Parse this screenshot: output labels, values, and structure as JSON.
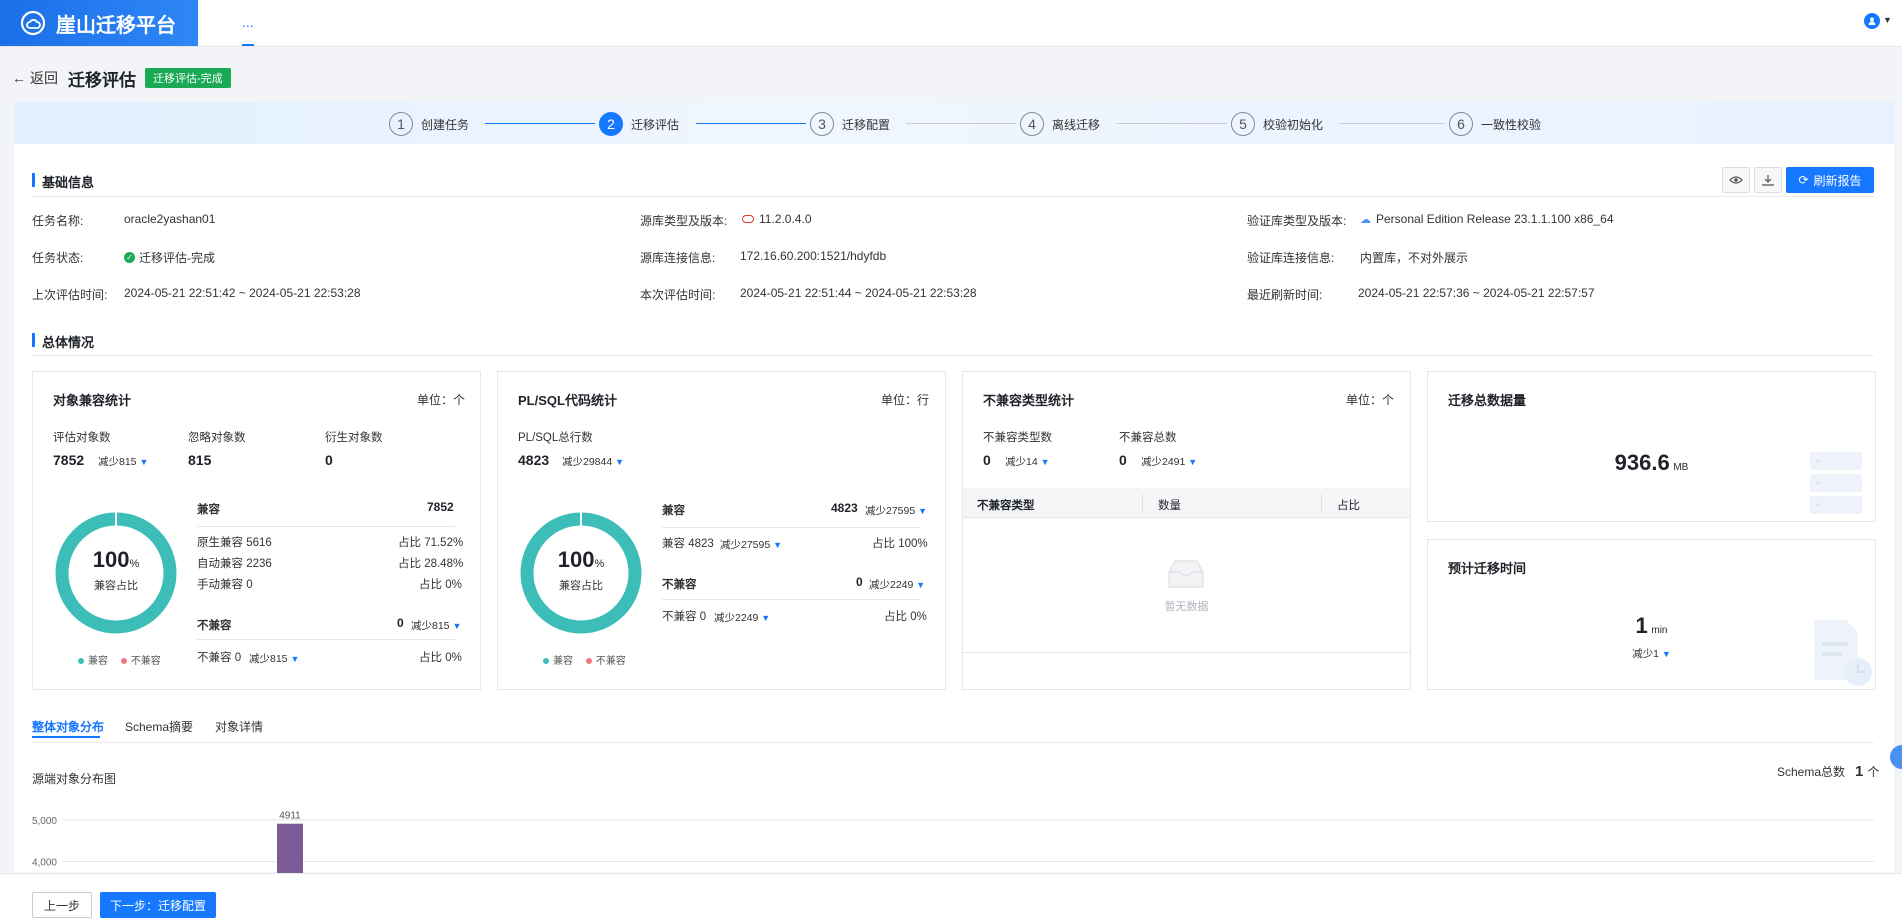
{
  "app": {
    "title": "崖山迁移平台",
    "nav_more": "..."
  },
  "header": {
    "back_label": "返回",
    "page_title": "迁移评估",
    "status_tag": "迁移评估-完成"
  },
  "steps": [
    {
      "num": "1",
      "label": "创建任务"
    },
    {
      "num": "2",
      "label": "迁移评估"
    },
    {
      "num": "3",
      "label": "迁移配置"
    },
    {
      "num": "4",
      "label": "离线迁移"
    },
    {
      "num": "5",
      "label": "校验初始化"
    },
    {
      "num": "6",
      "label": "一致性校验"
    }
  ],
  "basic": {
    "title": "基础信息",
    "refresh_label": "刷新报告",
    "task_name_label": "任务名称:",
    "task_name": "oracle2yashan01",
    "task_status_label": "任务状态:",
    "task_status": "迁移评估-完成",
    "last_eval_label": "上次评估时间:",
    "last_eval": "2024-05-21 22:51:42 ~ 2024-05-21 22:53:28",
    "src_type_label": "源库类型及版本:",
    "src_type": "11.2.0.4.0",
    "src_conn_label": "源库连接信息:",
    "src_conn": "172.16.60.200:1521/hdyfdb",
    "this_eval_label": "本次评估时间:",
    "this_eval": "2024-05-21 22:51:44 ~ 2024-05-21 22:53:28",
    "dst_type_label": "验证库类型及版本:",
    "dst_type": "Personal Edition Release 23.1.1.100 x86_64",
    "dst_conn_label": "验证库连接信息:",
    "dst_conn": "内置库，不对外展示",
    "refresh_time_label": "最近刷新时间:",
    "refresh_time": "2024-05-21 22:57:36 ~ 2024-05-21 22:57:57"
  },
  "overall": {
    "title": "总体情况"
  },
  "obj_card": {
    "title": "对象兼容统计",
    "unit": "单位：个",
    "eval_label": "评估对象数",
    "eval_value": "7852",
    "eval_delta": "减少815",
    "ignore_label": "忽略对象数",
    "ignore_value": "815",
    "derive_label": "衍生对象数",
    "derive_value": "0",
    "donut_pct": "100",
    "donut_pct_unit": "%",
    "donut_label": "兼容占比",
    "compat_label": "兼容",
    "compat_value": "7852",
    "native_label": "原生兼容 5616",
    "native_ratio": "占比 71.52%",
    "auto_label": "自动兼容 2236",
    "auto_ratio": "占比 28.48%",
    "manual_label": "手动兼容 0",
    "manual_ratio": "占比 0%",
    "incompat_label": "不兼容",
    "incompat_value": "0",
    "incompat_delta": "减少815",
    "incompat_row_label": "不兼容 0",
    "incompat_row_delta": "减少815",
    "incompat_row_ratio": "占比 0%",
    "legend_compat": "兼容",
    "legend_incompat": "不兼容"
  },
  "plsql_card": {
    "title": "PL/SQL代码统计",
    "unit": "单位：行",
    "total_label": "PL/SQL总行数",
    "total_value": "4823",
    "total_delta": "减少29844",
    "donut_pct": "100",
    "donut_pct_unit": "%",
    "donut_label": "兼容占比",
    "compat_label": "兼容",
    "compat_value": "4823",
    "compat_delta": "减少27595",
    "compat_row_label": "兼容 4823",
    "compat_row_delta": "减少27595",
    "compat_row_ratio": "占比 100%",
    "incompat_label": "不兼容",
    "incompat_value": "0",
    "incompat_delta": "减少2249",
    "incompat_row_label": "不兼容 0",
    "incompat_row_delta": "减少2249",
    "incompat_row_ratio": "占比 0%",
    "legend_compat": "兼容",
    "legend_incompat": "不兼容"
  },
  "incompat_card": {
    "title": "不兼容类型统计",
    "unit": "单位：个",
    "types_label": "不兼容类型数",
    "types_value": "0",
    "types_delta": "减少14",
    "total_label": "不兼容总数",
    "total_value": "0",
    "total_delta": "减少2491",
    "col_type": "不兼容类型",
    "col_count": "数量",
    "col_ratio": "占比",
    "empty_text": "暂无数据"
  },
  "volume_card": {
    "title": "迁移总数据量",
    "value": "936.6",
    "unit": "MB"
  },
  "time_card": {
    "title": "预计迁移时间",
    "value": "1",
    "unit": "min",
    "delta": "减少1"
  },
  "tabs": [
    "整体对象分布",
    "Schema摘要",
    "对象详情"
  ],
  "dist": {
    "title": "源端对象分布图",
    "schema_total_label": "Schema总数",
    "schema_total_value": "1",
    "schema_total_unit": "个"
  },
  "chart_data": {
    "type": "bar",
    "title": "源端对象分布图",
    "values": [
      4911
    ],
    "data_labels": [
      "4911"
    ],
    "y_ticks": [
      "5,000",
      "4,000"
    ],
    "colors": {
      "bar": "#7b5a96"
    }
  },
  "footer": {
    "prev_label": "上一步",
    "next_label": "下一步：迁移配置"
  },
  "colors": {
    "primary": "#1677ff",
    "teal": "#3cbdb8",
    "incompat": "#f0767b",
    "success": "#1aaa55"
  }
}
